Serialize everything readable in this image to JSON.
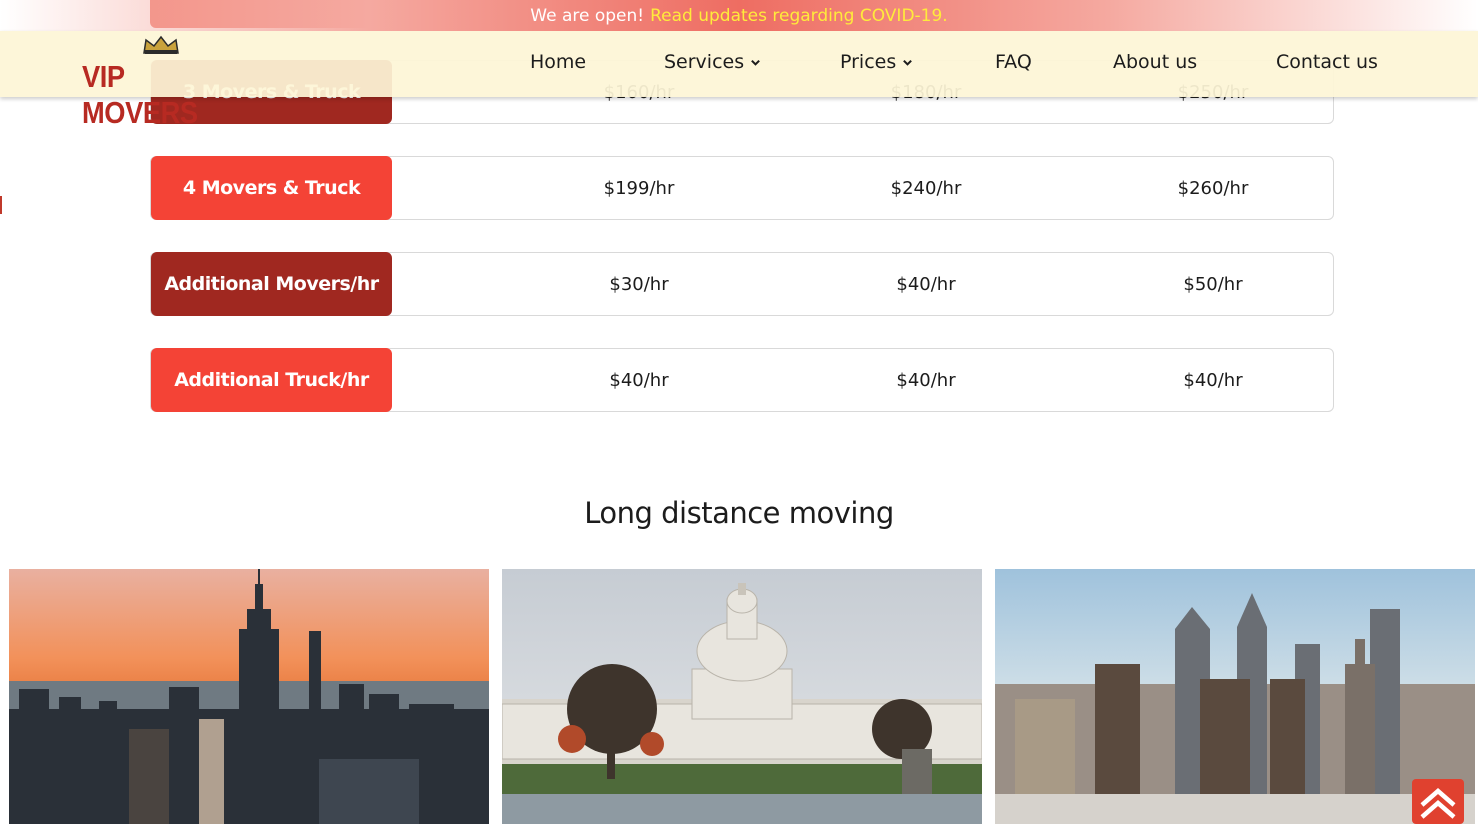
{
  "banner": {
    "text": "We are open!",
    "link_text": "Read updates regarding COVID-19."
  },
  "header": {
    "logo_text": "VIP MOVERS",
    "nav": [
      {
        "label": "Home"
      },
      {
        "label": "Services"
      },
      {
        "label": "Prices"
      },
      {
        "label": "FAQ"
      },
      {
        "label": "About us"
      },
      {
        "label": "Contact us"
      }
    ]
  },
  "pricing": {
    "rows": [
      {
        "label": "3 Movers & Truck",
        "prices": [
          "$160/hr",
          "$180/hr",
          "$250/hr"
        ]
      },
      {
        "label": "4 Movers & Truck",
        "prices": [
          "$199/hr",
          "$240/hr",
          "$260/hr"
        ]
      },
      {
        "label": "Additional Movers/hr",
        "prices": [
          "$30/hr",
          "$40/hr",
          "$50/hr"
        ]
      },
      {
        "label": "Additional Truck/hr",
        "prices": [
          "$40/hr",
          "$40/hr",
          "$40/hr"
        ]
      }
    ]
  },
  "long_distance": {
    "title": "Long distance moving"
  },
  "colors": {
    "accent_red": "#f44336",
    "dark_red": "#a02820",
    "banner_link": "#ffeb3b",
    "nav_bg": "#fdf5d6"
  }
}
